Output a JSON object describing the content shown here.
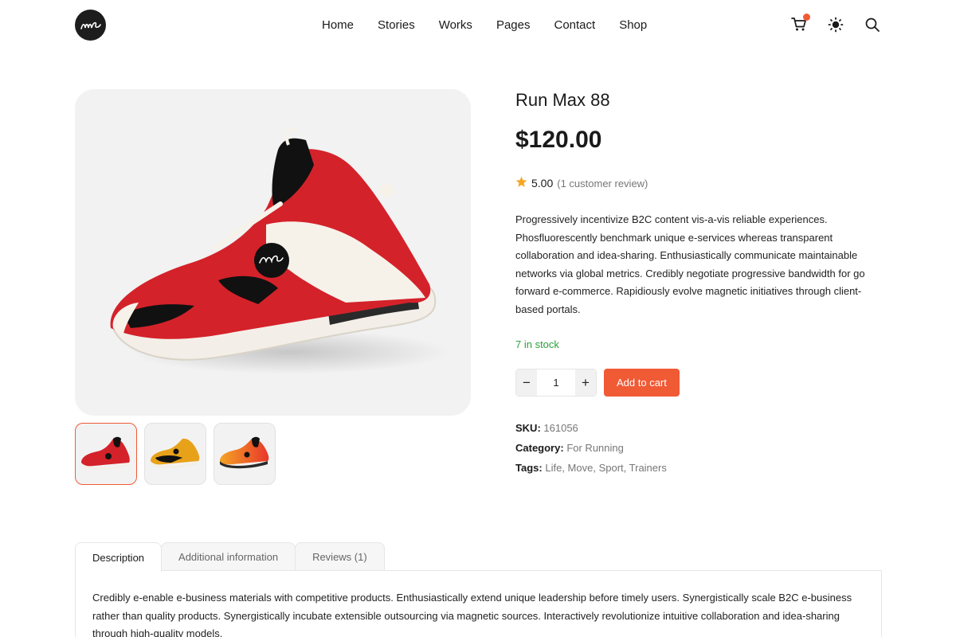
{
  "header": {
    "logo_icon": "signature-logo-icon",
    "nav": [
      "Home",
      "Stories",
      "Works",
      "Pages",
      "Contact",
      "Shop"
    ],
    "icons": [
      "cart-icon",
      "sun-icon",
      "search-icon"
    ],
    "cart_badge_color": "#f05a35"
  },
  "gallery": {
    "thumbnails": [
      "red-black-shoe",
      "yellow-black-shoe",
      "orange-gradient-shoe"
    ],
    "active_index": 0
  },
  "product": {
    "title": "Run Max 88",
    "price": "$120.00",
    "rating": "5.00",
    "review_text": "(1 customer review)",
    "description": "Progressively incentivize B2C content vis-a-vis reliable experiences. Phosfluorescently benchmark unique e-services whereas transparent collaboration and idea-sharing. Enthusiastically communicate maintainable networks via global metrics. Credibly negotiate progressive bandwidth for go forward e-commerce. Rapidiously evolve magnetic initiatives through client-based portals.",
    "stock": "7 in stock",
    "quantity": "1",
    "minus_label": "−",
    "plus_label": "+",
    "add_to_cart": "Add to cart",
    "sku_label": "SKU:",
    "sku": "161056",
    "category_label": "Category:",
    "category": "For Running",
    "tags_label": "Tags:",
    "tags": [
      "Life",
      "Move",
      "Sport",
      "Trainers"
    ]
  },
  "tabs": {
    "items": [
      "Description",
      "Additional information",
      "Reviews (1)"
    ],
    "active": 0,
    "description_text": "Credibly e-enable e-business materials with competitive products. Enthusiastically extend unique leadership before timely users. Synergistically scale B2C e-business rather than quality products. Synergistically incubate extensible outsourcing via magnetic sources. Interactively revolutionize intuitive collaboration and idea-sharing through high-quality models."
  },
  "colors": {
    "accent": "#f05a35",
    "stock_green": "#2e9e3d",
    "star": "#f5a623"
  }
}
